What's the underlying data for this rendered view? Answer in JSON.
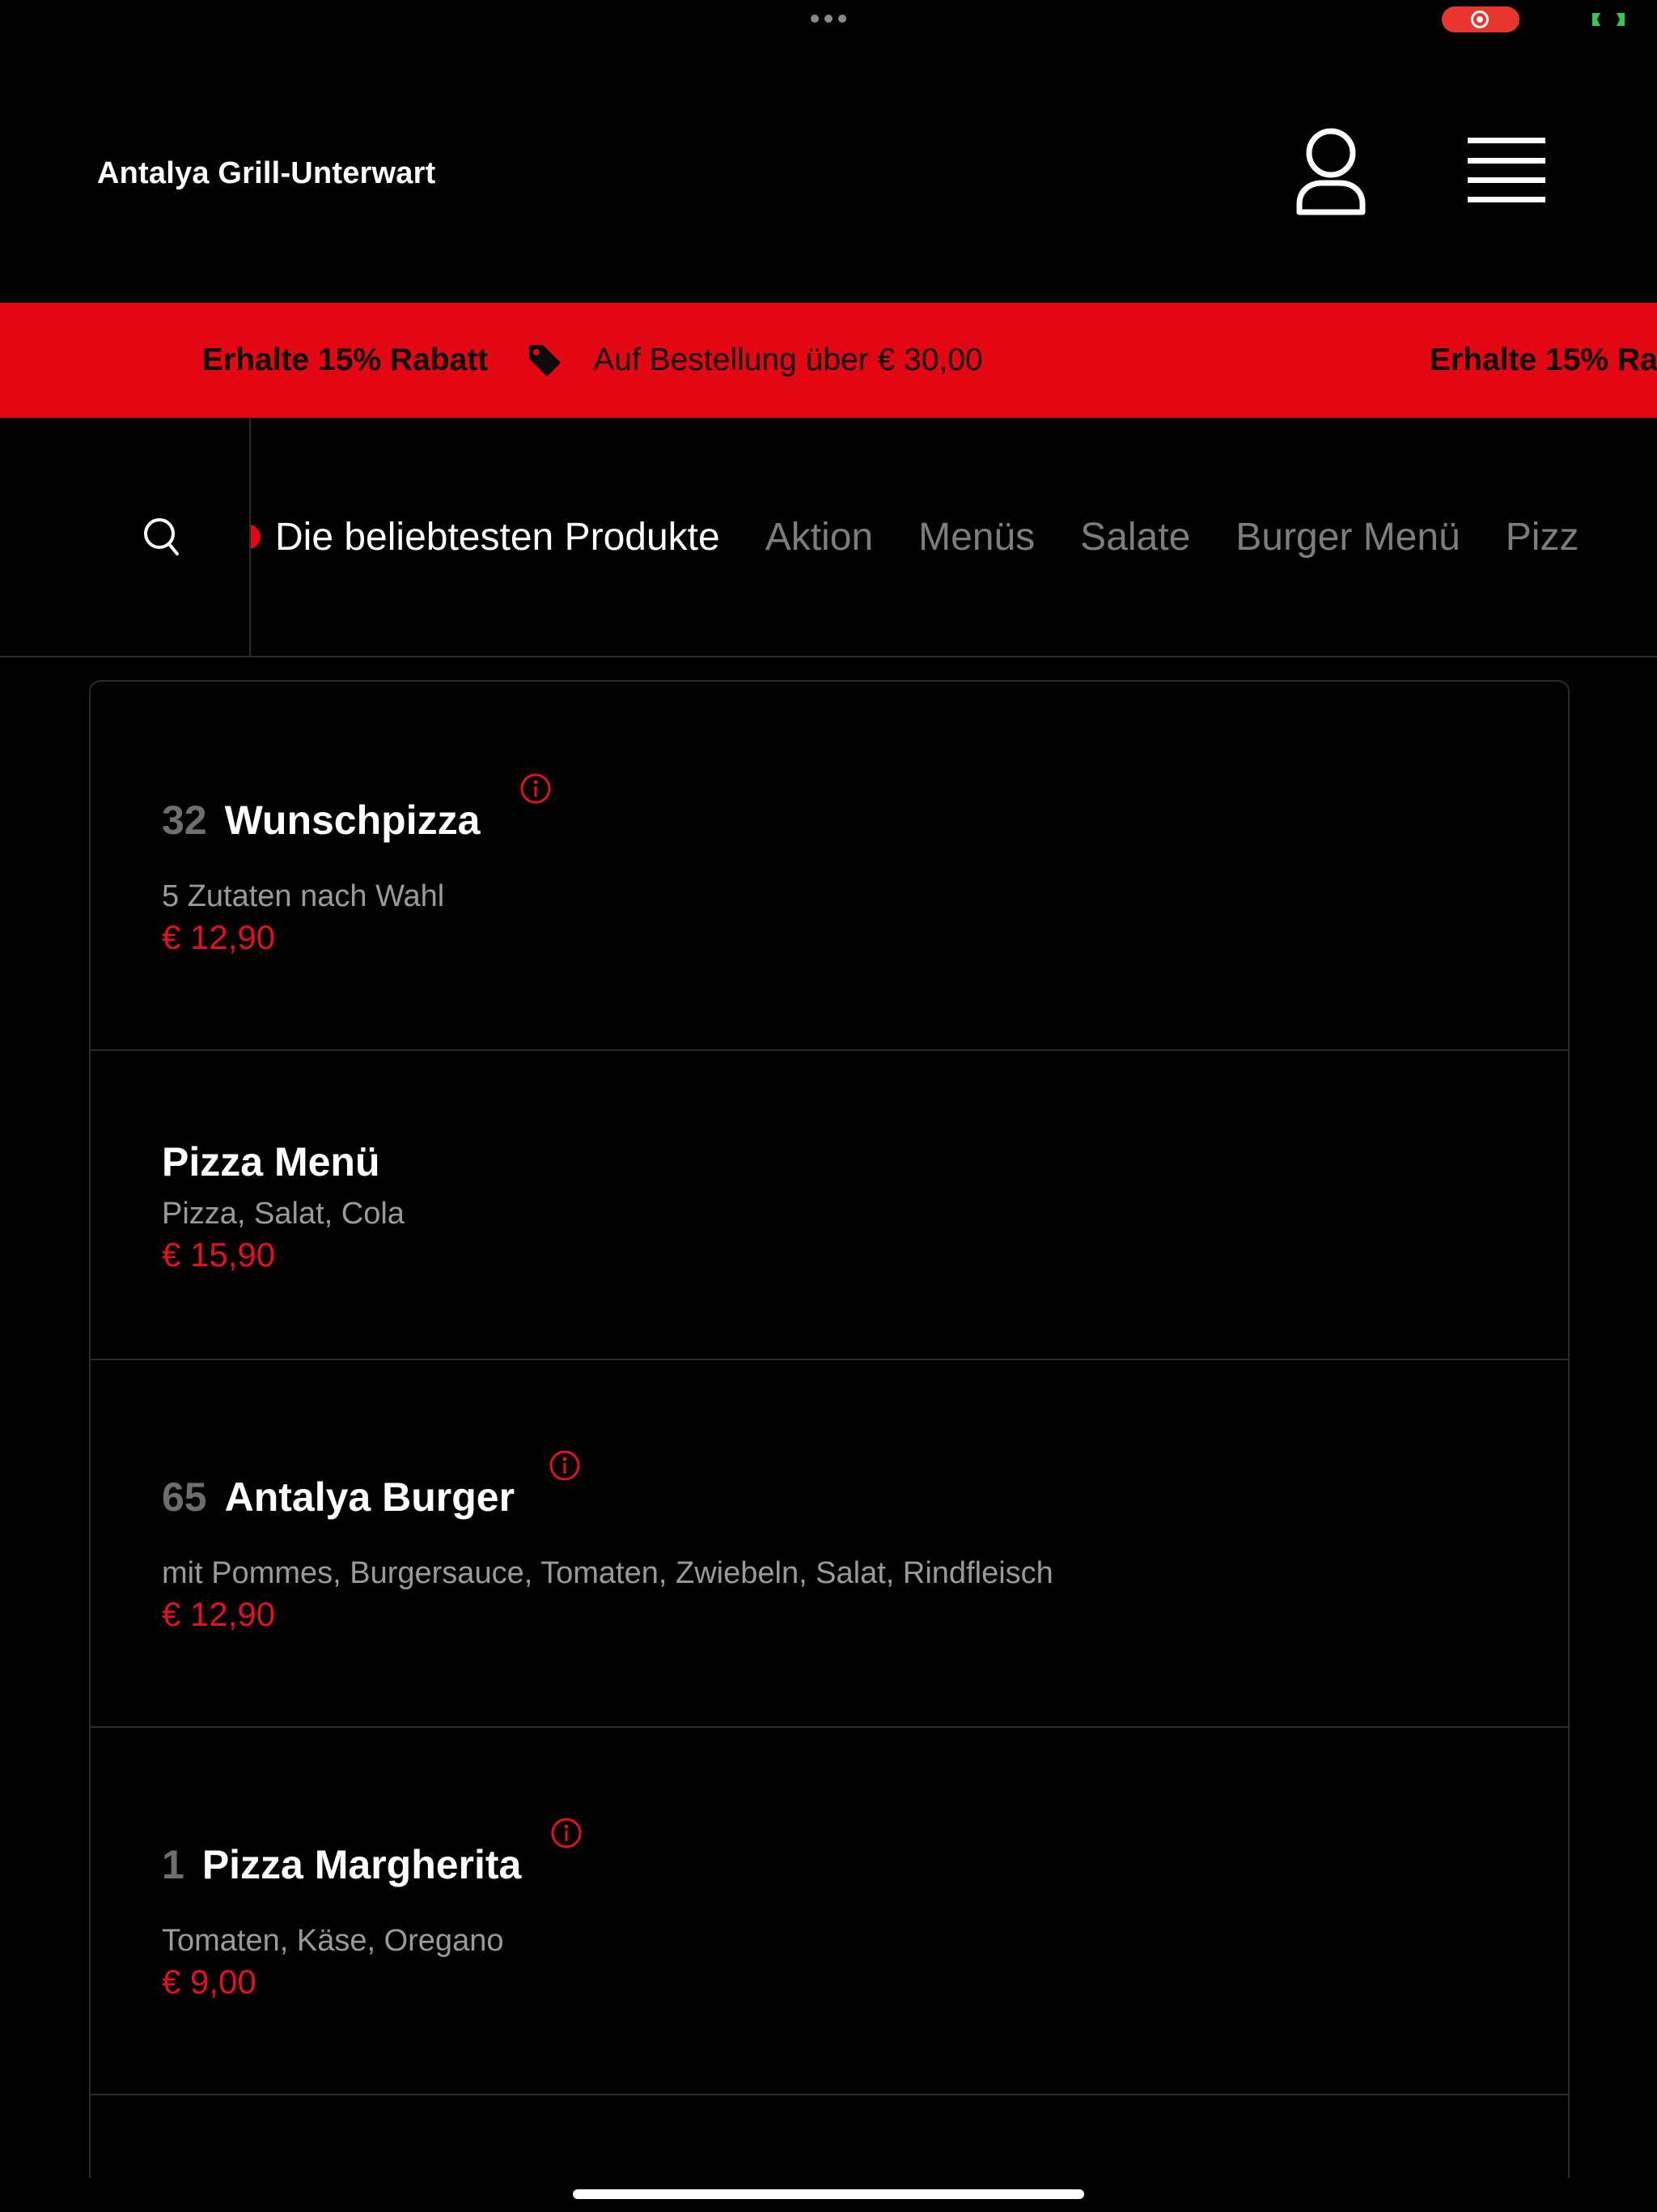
{
  "header": {
    "brand": "Antalya Grill-Unterwart"
  },
  "promo": {
    "headline": "Erhalte 15% Rabatt",
    "condition": "Auf Bestellung über € 30,00",
    "headline_repeat": "Erhalte 15% Ra"
  },
  "categories": [
    {
      "label": "Die beliebtesten Produkte",
      "active": true
    },
    {
      "label": "Aktion"
    },
    {
      "label": "Menüs"
    },
    {
      "label": "Salate"
    },
    {
      "label": "Burger Menü"
    },
    {
      "label": "Pizz"
    }
  ],
  "products": [
    {
      "number": "32",
      "name": "Wunschpizza",
      "description": "5 Zutaten nach Wahl",
      "price": "€ 12,90",
      "has_info": true
    },
    {
      "number": "",
      "name": "Pizza Menü",
      "description": "Pizza, Salat, Cola",
      "price": "€ 15,90",
      "has_info": false
    },
    {
      "number": "65",
      "name": "Antalya Burger",
      "description": "mit Pommes, Burgersauce, Tomaten, Zwiebeln, Salat, Rindfleisch",
      "price": "€ 12,90",
      "has_info": true
    },
    {
      "number": "1",
      "name": "Pizza Margherita",
      "description": "Tomaten, Käse, Oregano",
      "price": "€ 9,00",
      "has_info": true
    }
  ],
  "colors": {
    "accent": "#e30613",
    "price": "#e0121f",
    "background": "#000000"
  },
  "icons": {
    "account": "user-icon",
    "menu": "hamburger-icon",
    "search": "search-icon",
    "tag": "tag-icon",
    "info": "info-icon"
  }
}
